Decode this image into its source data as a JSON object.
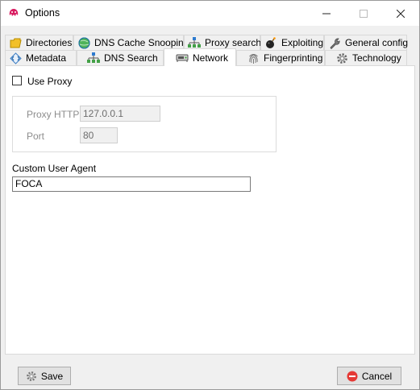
{
  "window": {
    "title": "Options"
  },
  "tabs_row1": [
    {
      "label": "Directories",
      "icon": "folder-icon"
    },
    {
      "label": "DNS Cache Snooping",
      "icon": "globe-icon"
    },
    {
      "label": "Proxy search",
      "icon": "network-tree-icon"
    },
    {
      "label": "Exploiting",
      "icon": "bomb-icon"
    },
    {
      "label": "General config",
      "icon": "wrench-icon"
    }
  ],
  "tabs_row2": [
    {
      "label": "Metadata",
      "icon": "metadata-icon"
    },
    {
      "label": "DNS Search",
      "icon": "network-tree-icon"
    },
    {
      "label": "Network",
      "icon": "network-device-icon",
      "active": true
    },
    {
      "label": "Fingerprinting",
      "icon": "fingerprint-icon"
    },
    {
      "label": "Technology",
      "icon": "gear-icon"
    }
  ],
  "network": {
    "use_proxy_label": "Use Proxy",
    "use_proxy_checked": false,
    "proxy_http_label": "Proxy HTTP",
    "proxy_http_value": "127.0.0.1",
    "port_label": "Port",
    "port_value": "80",
    "custom_ua_label": "Custom User Agent",
    "custom_ua_value": "FOCA"
  },
  "buttons": {
    "save": "Save",
    "cancel": "Cancel"
  },
  "colors": {
    "cancel_icon": "#e53935",
    "app_icon": "#d81b60"
  }
}
